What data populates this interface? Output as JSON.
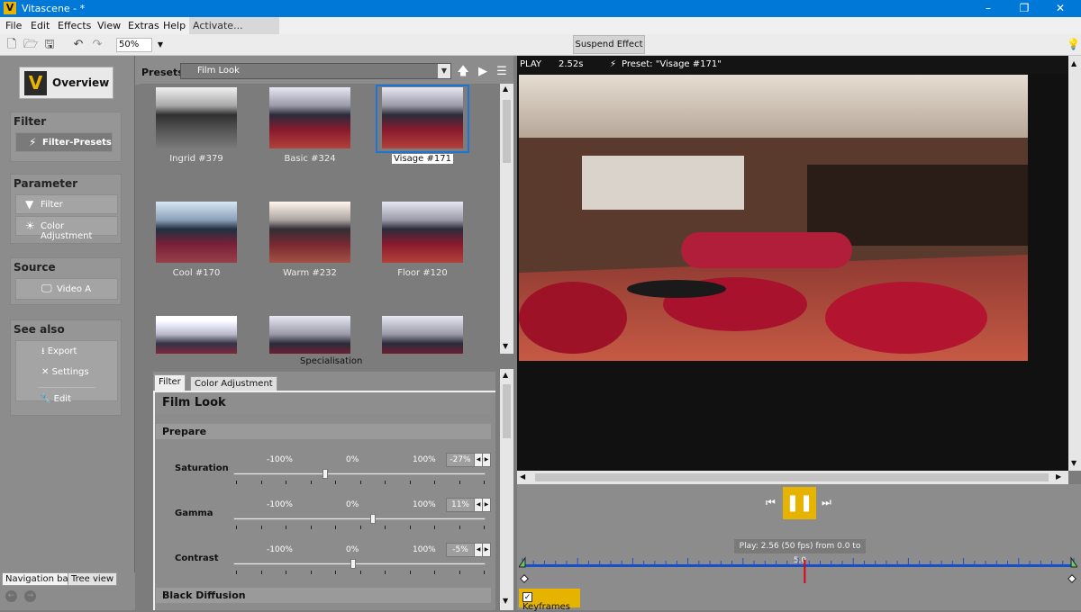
{
  "window": {
    "title": "Vitascene - *",
    "logo_letter": "V",
    "minimize": "–",
    "maximize": "❐",
    "close": "✕"
  },
  "menu": {
    "items": [
      "File",
      "Edit",
      "Effects",
      "View",
      "Extras",
      "Help"
    ],
    "activate": "Activate..."
  },
  "toolbar": {
    "zoom": "50%",
    "suspend": "Suspend Effect",
    "icons": [
      "new-file-icon",
      "open-folder-icon",
      "save-icon",
      "undo-icon",
      "redo-icon"
    ]
  },
  "leftpanel": {
    "overview": "Overview",
    "filter": {
      "header": "Filter",
      "items": [
        "Filter-Presets"
      ]
    },
    "parameter": {
      "header": "Parameter",
      "items": [
        "Filter",
        "Color Adjustment"
      ]
    },
    "source": {
      "header": "Source",
      "items": [
        "Video A"
      ]
    },
    "seealso": {
      "header": "See also",
      "items": [
        "Export",
        "Settings",
        "Edit"
      ]
    },
    "tabs": [
      "Navigation bar",
      "Tree view"
    ]
  },
  "presets": {
    "label": "Presets",
    "selected": "Film Look",
    "thumbnails": [
      "Ingrid #379",
      "Basic #324",
      "Visage #171",
      "Cool #170",
      "Warm #232",
      "Floor #120"
    ],
    "specialisation": "Specialisation"
  },
  "params": {
    "tabs": [
      "Filter",
      "Color Adjustment"
    ],
    "title": "Film Look",
    "section1": "Prepare",
    "section2": "Black Diffusion",
    "tick_min": "-100%",
    "tick_mid": "0%",
    "tick_max": "100%",
    "rows": [
      {
        "label": "Saturation",
        "value": "-27%",
        "level": -27
      },
      {
        "label": "Gamma",
        "value": "11%",
        "level": 11
      },
      {
        "label": "Contrast",
        "value": "-5%",
        "level": -5
      }
    ]
  },
  "viewer": {
    "mode": "PLAY",
    "time": "2.52s",
    "preset": "Preset: \"Visage #171\""
  },
  "transport": {
    "play_info": "Play: 2.56 (50 fps) from 0.0 to 5.0",
    "keyframes": "Keyframes",
    "playhead_fraction": 0.512
  }
}
